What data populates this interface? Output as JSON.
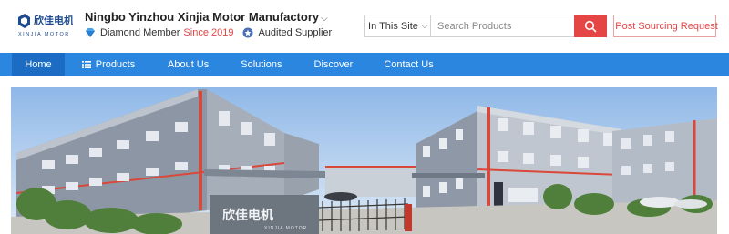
{
  "header": {
    "logo_text": "欣佳电机",
    "logo_subtext": "XINJIA MOTOR",
    "company_name": "Ningbo Yinzhou Xinjia Motor Manufactory",
    "diamond_label": "Diamond Member",
    "since_label": "Since 2019",
    "audited_label": "Audited Supplier"
  },
  "search": {
    "scope": "In This Site",
    "placeholder": "Search Products",
    "post_label": "Post Sourcing Request"
  },
  "nav": {
    "home": "Home",
    "products": "Products",
    "about": "About Us",
    "solutions": "Solutions",
    "discover": "Discover",
    "contact": "Contact Us"
  },
  "banner": {
    "sign_text": "欣佳电机",
    "sign_subtext": "XINJIA MOTOR"
  },
  "colors": {
    "accent_red": "#e64545",
    "nav_blue": "#2b86e0",
    "nav_active": "#1b6cc2"
  }
}
